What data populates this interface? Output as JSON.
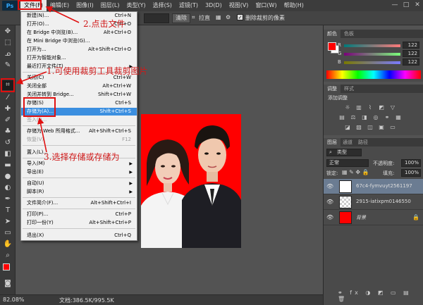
{
  "menubar": {
    "logo": "Ps",
    "items": [
      {
        "label": "文件(F)",
        "active": true
      },
      {
        "label": "编辑(E)"
      },
      {
        "label": "图像(I)"
      },
      {
        "label": "图层(L)"
      },
      {
        "label": "类型(Y)"
      },
      {
        "label": "选择(S)"
      },
      {
        "label": "滤镜(T)"
      },
      {
        "label": "3D(D)"
      },
      {
        "label": "视图(V)"
      },
      {
        "label": "窗口(W)"
      },
      {
        "label": "帮助(H)"
      }
    ],
    "window_controls": [
      "—",
      "□",
      "✕"
    ]
  },
  "optbar": {
    "clear_label": "清除",
    "straighten_label": "拉直",
    "delete_cropped_label": "删除裁剪的像素",
    "delete_cropped_checked": true
  },
  "file_menu": {
    "items": [
      {
        "label": "新建(N)...",
        "shortcut": "Ctrl+N"
      },
      {
        "label": "打开(O)...",
        "shortcut": "Ctrl+O"
      },
      {
        "label": "在 Bridge 中浏览(B)...",
        "shortcut": "Alt+Ctrl+O"
      },
      {
        "label": "在 Mini Bridge 中浏览(G)...",
        "shortcut": ""
      },
      {
        "label": "打开为...",
        "shortcut": "Alt+Shift+Ctrl+O"
      },
      {
        "label": "打开为智能对象...",
        "shortcut": ""
      },
      {
        "label": "最近打开文件(T)",
        "shortcut": "",
        "submenu": true
      },
      {
        "label": "关闭(C)",
        "shortcut": "Ctrl+W"
      },
      {
        "label": "关闭全部",
        "shortcut": "Alt+Ctrl+W"
      },
      {
        "label": "关闭并转到 Bridge...",
        "shortcut": "Shift+Ctrl+W"
      },
      {
        "label": "存储(S)",
        "shortcut": "Ctrl+S"
      },
      {
        "label": "存储为(A)...",
        "shortcut": "Shift+Ctrl+S",
        "highlighted": true
      },
      {
        "label": "签入(I)...",
        "shortcut": "",
        "disabled": true
      },
      {
        "label": "存储为 Web 所用格式...",
        "shortcut": "Alt+Shift+Ctrl+S"
      },
      {
        "label": "恢复(V)",
        "shortcut": "F12",
        "disabled": true
      },
      {
        "label": "置入(L)...",
        "shortcut": ""
      },
      {
        "label": "导入(M)",
        "shortcut": "",
        "submenu": true
      },
      {
        "label": "导出(E)",
        "shortcut": "",
        "submenu": true
      },
      {
        "label": "自动(U)",
        "shortcut": "",
        "submenu": true
      },
      {
        "label": "脚本(R)",
        "shortcut": "",
        "submenu": true
      },
      {
        "label": "文件简介(F)...",
        "shortcut": "Alt+Shift+Ctrl+I"
      },
      {
        "label": "打印(P)...",
        "shortcut": "Ctrl+P"
      },
      {
        "label": "打印一份(Y)",
        "shortcut": "Alt+Shift+Ctrl+P"
      },
      {
        "label": "退出(X)",
        "shortcut": "Ctrl+Q"
      }
    ]
  },
  "annotations": {
    "step1": "1.可使用裁剪工具裁剪图片",
    "step2": "2.点击文件",
    "step3": "3.选择存储或存储为"
  },
  "statusbar": {
    "zoom": "82.08%",
    "docsize": "文档:386.5K/995.5K"
  },
  "color_panel": {
    "tabs": [
      "颜色",
      "色板"
    ],
    "r": "122",
    "g": "122",
    "b": "122",
    "r_label": "R",
    "g_label": "G",
    "b_label": "B",
    "fg_color": "#ff0000",
    "bg_color": "#ffffff"
  },
  "adjust_panel": {
    "tabs": [
      "调整",
      "样式"
    ],
    "title": "添加调整"
  },
  "layers_panel": {
    "tabs": [
      "图层",
      "通道",
      "路径"
    ],
    "filter_label": "类型",
    "blend_mode": "正常",
    "opacity_label": "不透明度:",
    "opacity": "100%",
    "lock_label": "锁定:",
    "fill_label": "填充:",
    "fill": "100%",
    "layers": [
      {
        "name": "67c4-fymvuyt2561197",
        "selected": true
      },
      {
        "name": "2915-iatixpm0146550",
        "selected": false
      },
      {
        "name": "背景",
        "selected": false
      }
    ]
  }
}
